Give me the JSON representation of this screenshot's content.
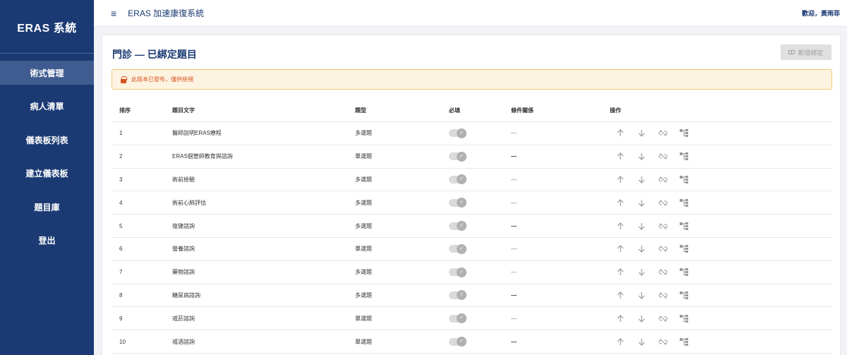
{
  "app": {
    "brand": "ERAS 系統"
  },
  "sidebar": {
    "items": [
      {
        "label": "術式管理",
        "active": true
      },
      {
        "label": "病人清單"
      },
      {
        "label": "儀表板列表"
      },
      {
        "label": "建立儀表板"
      },
      {
        "label": "題目庫"
      },
      {
        "label": "登出"
      }
    ]
  },
  "topbar": {
    "menu_icon": "≡",
    "title": "ERAS 加速康復系統",
    "welcome": "歡迎，黃雨菲"
  },
  "page": {
    "title": "門診 — 已綁定題目",
    "add_button": "新增綁定",
    "alert": "此版本已發布，僅供檢視"
  },
  "table": {
    "headers": [
      "排序",
      "題目文字",
      "題型",
      "必填",
      "條件關係",
      "操作"
    ],
    "rows": [
      {
        "order": "1",
        "text": "醫師說明ERAS療程",
        "type": "多選題",
        "condition": "—",
        "bold": false
      },
      {
        "order": "2",
        "text": "ERAS個管師教育與諮詢",
        "type": "單選題",
        "condition": "—",
        "bold": true
      },
      {
        "order": "3",
        "text": "術前檢驗",
        "type": "多選題",
        "condition": "—",
        "bold": false
      },
      {
        "order": "4",
        "text": "術前心肺評估",
        "type": "多選題",
        "condition": "—",
        "bold": false
      },
      {
        "order": "5",
        "text": "復健諮詢",
        "type": "多選題",
        "condition": "—",
        "bold": true
      },
      {
        "order": "6",
        "text": "營養諮詢",
        "type": "單選題",
        "condition": "—",
        "bold": false
      },
      {
        "order": "7",
        "text": "藥物諮詢",
        "type": "多選題",
        "condition": "—",
        "bold": false
      },
      {
        "order": "8",
        "text": "糖尿病諮詢",
        "type": "多選題",
        "condition": "—",
        "bold": true
      },
      {
        "order": "9",
        "text": "戒菸諮詢",
        "type": "單選題",
        "condition": "—",
        "bold": false
      },
      {
        "order": "10",
        "text": "戒酒諮詢",
        "type": "單選題",
        "condition": "—",
        "bold": true
      }
    ]
  },
  "icons": {
    "up": "arrow-up-icon",
    "down": "arrow-down-icon",
    "unlink": "unlink-icon",
    "tree": "tree-icon",
    "check": "check-icon",
    "lock": "lock-icon"
  }
}
